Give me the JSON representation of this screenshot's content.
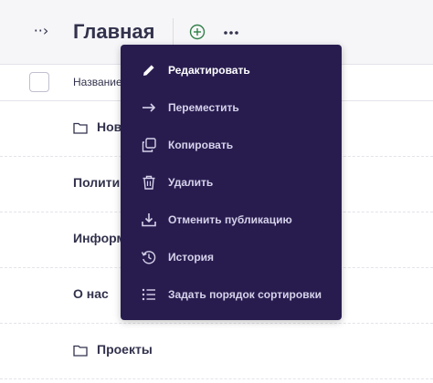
{
  "header": {
    "toggle_glyph": "··›",
    "title": "Главная"
  },
  "list": {
    "column_name": "Название"
  },
  "rows": [
    {
      "label": "Новости",
      "icon": "folder-icon"
    },
    {
      "label": "Политика",
      "icon": null
    },
    {
      "label": "Информация",
      "icon": null
    },
    {
      "label": "О нас",
      "icon": null
    },
    {
      "label": "Проекты",
      "icon": "folder-icon"
    }
  ],
  "menu": {
    "items": [
      {
        "label": "Редактировать",
        "icon": "pencil-icon"
      },
      {
        "label": "Переместить",
        "icon": "arrow-right-icon"
      },
      {
        "label": "Копировать",
        "icon": "copy-icon"
      },
      {
        "label": "Удалить",
        "icon": "trash-icon"
      },
      {
        "label": "Отменить публикацию",
        "icon": "unpublish-icon"
      },
      {
        "label": "История",
        "icon": "history-icon"
      },
      {
        "label": "Задать порядок сортировки",
        "icon": "sort-list-icon"
      }
    ]
  },
  "colors": {
    "menu_bg": "#281c4f",
    "accent_green": "#328048",
    "text_dark": "#32324d"
  }
}
